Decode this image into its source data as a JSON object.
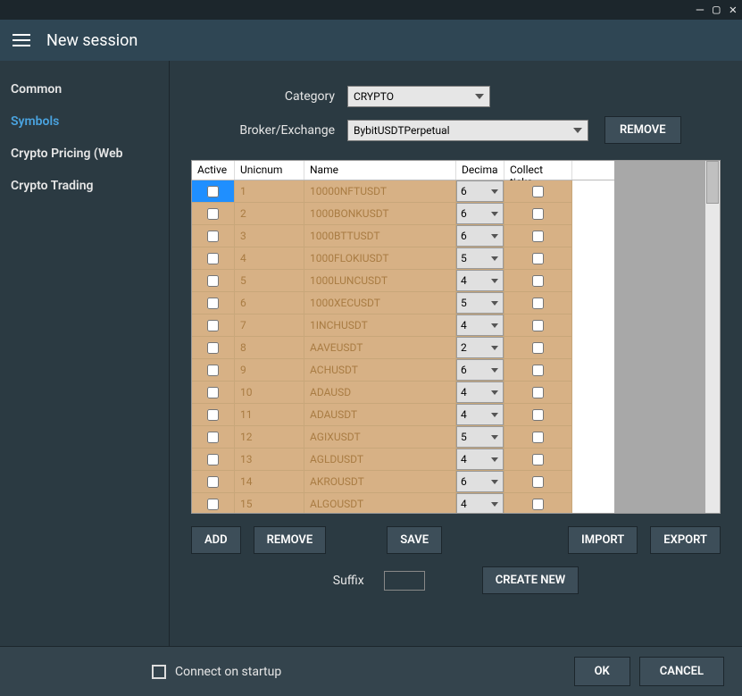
{
  "window": {
    "title": "New session"
  },
  "sidebar": {
    "items": [
      {
        "label": "Common",
        "active": false
      },
      {
        "label": "Symbols",
        "active": true
      },
      {
        "label": "Crypto Pricing (Web",
        "active": false
      },
      {
        "label": "Crypto Trading",
        "active": false
      }
    ]
  },
  "form": {
    "category_label": "Category",
    "category_value": "CRYPTO",
    "broker_label": "Broker/Exchange",
    "broker_value": "BybitUSDTPerpetual",
    "remove_top": "REMOVE"
  },
  "grid": {
    "headers": {
      "active": "Active",
      "unicnum": "Unicnum",
      "name": "Name",
      "decimal": "Decima",
      "ticks": "Collect ticks"
    },
    "rows": [
      {
        "active": false,
        "selected": true,
        "unicnum": "1",
        "name": "10000NFTUSDT",
        "decimal": "6",
        "ticks": false
      },
      {
        "active": false,
        "selected": false,
        "unicnum": "2",
        "name": "1000BONKUSDT",
        "decimal": "6",
        "ticks": false
      },
      {
        "active": false,
        "selected": false,
        "unicnum": "3",
        "name": "1000BTTUSDT",
        "decimal": "6",
        "ticks": false
      },
      {
        "active": false,
        "selected": false,
        "unicnum": "4",
        "name": "1000FLOKIUSDT",
        "decimal": "5",
        "ticks": false
      },
      {
        "active": false,
        "selected": false,
        "unicnum": "5",
        "name": "1000LUNCUSDT",
        "decimal": "4",
        "ticks": false
      },
      {
        "active": false,
        "selected": false,
        "unicnum": "6",
        "name": "1000XECUSDT",
        "decimal": "5",
        "ticks": false
      },
      {
        "active": false,
        "selected": false,
        "unicnum": "7",
        "name": "1INCHUSDT",
        "decimal": "4",
        "ticks": false
      },
      {
        "active": false,
        "selected": false,
        "unicnum": "8",
        "name": "AAVEUSDT",
        "decimal": "2",
        "ticks": false
      },
      {
        "active": false,
        "selected": false,
        "unicnum": "9",
        "name": "ACHUSDT",
        "decimal": "6",
        "ticks": false
      },
      {
        "active": false,
        "selected": false,
        "unicnum": "10",
        "name": "ADAUSD",
        "decimal": "4",
        "ticks": false
      },
      {
        "active": false,
        "selected": false,
        "unicnum": "11",
        "name": "ADAUSDT",
        "decimal": "4",
        "ticks": false
      },
      {
        "active": false,
        "selected": false,
        "unicnum": "12",
        "name": "AGIXUSDT",
        "decimal": "5",
        "ticks": false
      },
      {
        "active": false,
        "selected": false,
        "unicnum": "13",
        "name": "AGLDUSDT",
        "decimal": "4",
        "ticks": false
      },
      {
        "active": false,
        "selected": false,
        "unicnum": "14",
        "name": "AKROUSDT",
        "decimal": "6",
        "ticks": false
      },
      {
        "active": false,
        "selected": false,
        "unicnum": "15",
        "name": "ALGOUSDT",
        "decimal": "4",
        "ticks": false
      }
    ]
  },
  "buttons": {
    "add": "ADD",
    "remove": "REMOVE",
    "save": "SAVE",
    "import": "IMPORT",
    "export": "EXPORT",
    "create_new": "CREATE NEW",
    "suffix_label": "Suffix",
    "suffix_value": ""
  },
  "footer": {
    "connect_label": "Connect on startup",
    "connect_checked": false,
    "ok": "OK",
    "cancel": "CANCEL"
  }
}
